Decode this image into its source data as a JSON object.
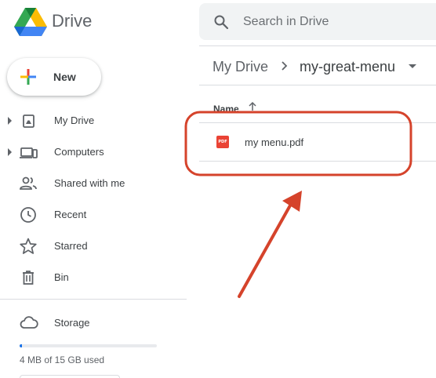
{
  "app": {
    "title": "Drive"
  },
  "search": {
    "placeholder": "Search in Drive",
    "icon": "search-icon"
  },
  "new_button": {
    "label": "New"
  },
  "sidebar": {
    "items": [
      {
        "label": "My Drive",
        "icon": "my-drive-icon",
        "expandable": true
      },
      {
        "label": "Computers",
        "icon": "computers-icon",
        "expandable": true
      },
      {
        "label": "Shared with me",
        "icon": "shared-icon",
        "expandable": false
      },
      {
        "label": "Recent",
        "icon": "clock-icon",
        "expandable": false
      },
      {
        "label": "Starred",
        "icon": "star-icon",
        "expandable": false
      },
      {
        "label": "Bin",
        "icon": "trash-icon",
        "expandable": false
      }
    ],
    "storage": {
      "label": "Storage",
      "icon": "cloud-icon",
      "usage_text": "4 MB of 15 GB used",
      "used_fraction": 0.0003
    }
  },
  "breadcrumb": {
    "root": "My Drive",
    "current": "my-great-menu"
  },
  "file_list": {
    "column_header": "Name",
    "sort": "ascending",
    "files": [
      {
        "name": "my menu.pdf",
        "type": "pdf",
        "icon_text": "PDF"
      }
    ]
  },
  "colors": {
    "annotation": "#d5432b",
    "accent_blue": "#1a73e8",
    "pdf_red": "#ea4335"
  }
}
